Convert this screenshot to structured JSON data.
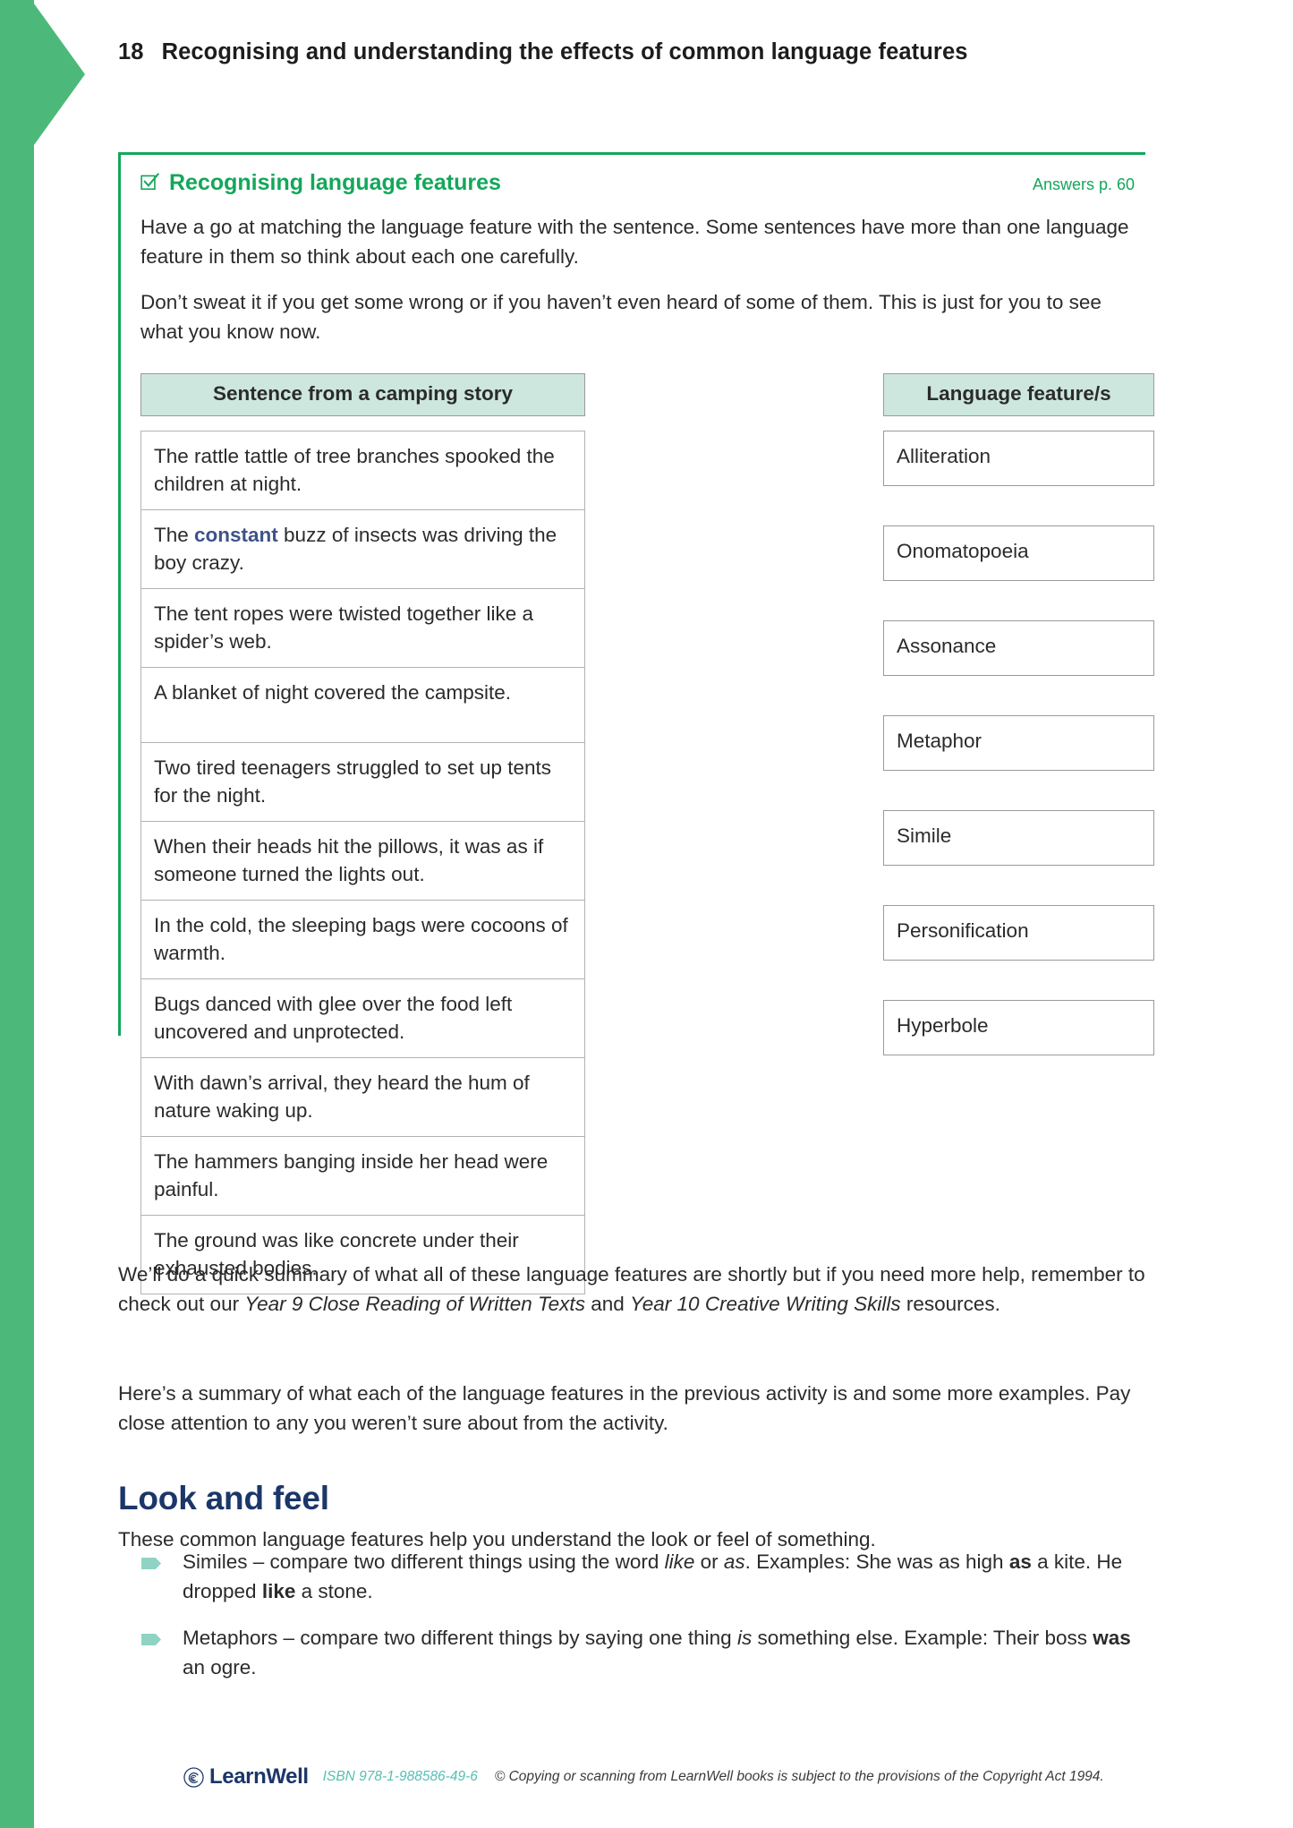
{
  "page": {
    "number": "18",
    "title": "Recognising and understanding the effects of common language features"
  },
  "activity": {
    "icon": "checkbox-ticked-icon",
    "title": "Recognising language features",
    "answers_ref": "Answers p. 60",
    "intro_1": "Have a go at matching the language feature with the sentence. Some sentences have more than one language feature in them so think about each one carefully.",
    "intro_2": "Don’t sweat it if you get some wrong or if you haven’t even heard of some of them. This is just for you to see what you know now.",
    "table": {
      "left_header": "Sentence from a camping story",
      "right_header": "Language feature/s",
      "sentences": [
        {
          "pre": "The rattle tattle of tree branches spooked the children at night.",
          "bold": "",
          "post": ""
        },
        {
          "pre": "The ",
          "bold": "constant",
          "post": " buzz of insects was driving the boy crazy."
        },
        {
          "pre": "The tent ropes were twisted together like a spider’s web.",
          "bold": "",
          "post": ""
        },
        {
          "pre": "A blanket of night covered the campsite.",
          "bold": "",
          "post": ""
        },
        {
          "pre": "Two tired teenagers struggled to set up tents for the night.",
          "bold": "",
          "post": ""
        },
        {
          "pre": "When their heads hit the pillows, it was as if someone turned the lights out.",
          "bold": "",
          "post": ""
        },
        {
          "pre": "In the cold, the sleeping bags were cocoons of warmth.",
          "bold": "",
          "post": ""
        },
        {
          "pre": "Bugs danced with glee over the food left uncovered and unprotected.",
          "bold": "",
          "post": ""
        },
        {
          "pre": "With dawn’s arrival, they heard the hum of nature waking up.",
          "bold": "",
          "post": ""
        },
        {
          "pre": "The hammers banging inside her head were painful.",
          "bold": "",
          "post": ""
        },
        {
          "pre": "The ground was like concrete under their exhausted bodies.",
          "bold": "",
          "post": ""
        }
      ],
      "features": [
        "Alliteration",
        "Onomatopoeia",
        "Assonance",
        "Metaphor",
        "Simile",
        "Personification",
        "Hyperbole"
      ]
    }
  },
  "after_table": {
    "p1_a": "We’ll do a quick summary of what all of these language features are shortly but if you need more help, remember to check out our ",
    "p1_i1": "Year 9 Close Reading of Written Texts",
    "p1_b": " and ",
    "p1_i2": "Year 10 Creative Writing Skills",
    "p1_c": " resources.",
    "p2": "Here’s a summary of what each of the language features in the previous activity is and some more examples. Pay close attention to any you weren’t sure about from the activity."
  },
  "section": {
    "heading": "Look and feel",
    "lead": "These common language features help you understand the look or feel of something.",
    "bullets": [
      {
        "a": "Similes – compare two different things using the word ",
        "i1": "like",
        "b": " or ",
        "i2": "as",
        "c": ". Examples: She was as high ",
        "b1": "as",
        "d": " a kite. He dropped ",
        "b2": "like",
        "e": " a stone."
      },
      {
        "a": "Metaphors – compare two different things by saying one thing ",
        "i1": "is",
        "b": " something else. Example: Their boss ",
        "b1": "was",
        "c": " an ogre."
      }
    ]
  },
  "footer": {
    "logo_icon": "spiral-logo-icon",
    "brand": "LearnWell",
    "isbn": "ISBN 978-1-988586-49-6",
    "copyright": "© Copying or scanning from LearnWell books is subject to the provisions of the Copyright Act 1994."
  },
  "colors": {
    "green_bar": "#4cb97a",
    "activity_green": "#13a75a",
    "header_fill": "#cde7de",
    "bold_blue": "#3f5289",
    "heading_navy": "#1b3668",
    "bullet_teal": "#8ed3c4",
    "isbn_teal": "#57bfb3"
  }
}
